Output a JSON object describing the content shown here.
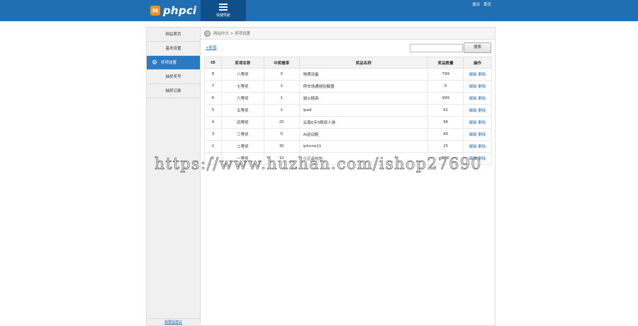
{
  "header": {
    "logo_badge": "M",
    "logo_text": "phpci",
    "quick_nav_label": "快捷导航",
    "links": [
      "退出",
      "首页"
    ]
  },
  "sidebar": {
    "items": [
      {
        "label": "网站首页",
        "active": false
      },
      {
        "label": "基本设置",
        "active": false
      },
      {
        "label": "奖项设置",
        "active": true
      },
      {
        "label": "抽奖奖号",
        "active": false
      },
      {
        "label": "抽奖记录",
        "active": false
      }
    ],
    "bottom_link": "我要提建议"
  },
  "breadcrumb": "网站中文 > 奖项设置",
  "toolbar": {
    "add_label": "+新增",
    "search_value": "",
    "search_button": "搜索"
  },
  "table": {
    "headers": [
      "ID",
      "奖项名称",
      "中奖概率",
      "奖品名称",
      "奖品数量",
      "操作"
    ],
    "rows": [
      {
        "id": "8",
        "award": "八等奖",
        "prob": "0",
        "prize": "物质设备",
        "qty": "799",
        "edit": "编辑",
        "del": "删除"
      },
      {
        "id": "7",
        "award": "七等奖",
        "prob": "1",
        "prize": "停车场通用验解器",
        "qty": "0",
        "edit": "编辑",
        "del": "删除"
      },
      {
        "id": "6",
        "award": "六等奖",
        "prob": "1",
        "prize": "骑士精英",
        "qty": "999",
        "edit": "编辑",
        "del": "删除"
      },
      {
        "id": "5",
        "award": "五等奖",
        "prob": "1",
        "prize": "ipad",
        "qty": "91",
        "edit": "编辑",
        "del": "删除"
      },
      {
        "id": "4",
        "award": "四等奖",
        "prob": "20",
        "prize": "云南6天5晚双人游",
        "qty": "96",
        "edit": "编辑",
        "del": "删除"
      },
      {
        "id": "3",
        "award": "三等奖",
        "prob": "0",
        "prize": "AI运动鞋",
        "qty": "40",
        "edit": "编辑",
        "del": "删除"
      },
      {
        "id": "2",
        "award": "二等奖",
        "prob": "30",
        "prize": "iphone11",
        "qty": "25",
        "edit": "编辑",
        "del": "删除"
      },
      {
        "id": "1",
        "award": "一等奖",
        "prob": "10",
        "prize": "小正品包包",
        "qty": "500",
        "edit": "编辑",
        "del": "删除"
      }
    ]
  },
  "watermark": "https://www.huzhan.com/ishop27690",
  "colors": {
    "header": "#1f6fb2",
    "quick_nav": "#104f8a",
    "active_item": "#2b7bc3",
    "logo_badge": "#f7941d",
    "link": "#2b6cb0"
  }
}
